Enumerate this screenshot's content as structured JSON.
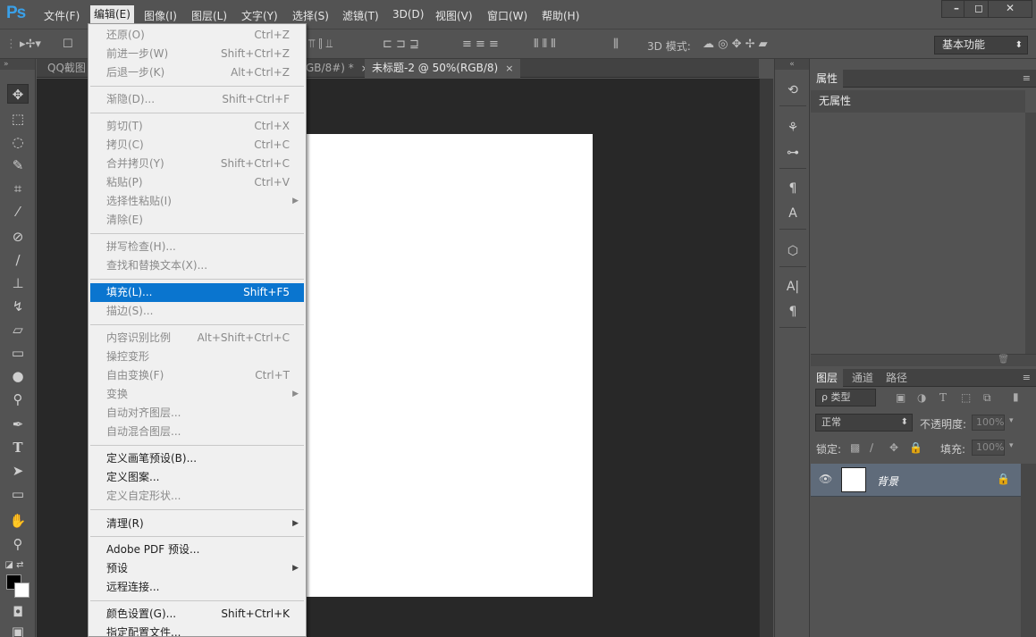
{
  "app": {
    "logo": "Ps",
    "menus": [
      "文件(F)",
      "编辑(E)",
      "图像(I)",
      "图层(L)",
      "文字(Y)",
      "选择(S)",
      "滤镜(T)",
      "3D(D)",
      "视图(V)",
      "窗口(W)",
      "帮助(H)"
    ],
    "window_controls": [
      "–",
      "◻",
      "✕"
    ]
  },
  "options_bar": {
    "mode_3d_label": "3D 模式:",
    "workspace": "基本功能"
  },
  "tabs": [
    {
      "label": "QQ截图",
      "close": ""
    },
    {
      "label": "GB/8#) *",
      "close": "×"
    },
    {
      "label": "未标题-2 @ 50%(RGB/8)",
      "close": "×"
    }
  ],
  "edit_menu": {
    "items": [
      {
        "label": "还原(O)",
        "shortcut": "Ctrl+Z",
        "disabled": true
      },
      {
        "label": "前进一步(W)",
        "shortcut": "Shift+Ctrl+Z",
        "disabled": true
      },
      {
        "label": "后退一步(K)",
        "shortcut": "Alt+Ctrl+Z",
        "disabled": true
      },
      {
        "label": "渐隐(D)...",
        "shortcut": "Shift+Ctrl+F",
        "disabled": true
      },
      {
        "label": "剪切(T)",
        "shortcut": "Ctrl+X",
        "disabled": true
      },
      {
        "label": "拷贝(C)",
        "shortcut": "Ctrl+C",
        "disabled": true
      },
      {
        "label": "合并拷贝(Y)",
        "shortcut": "Shift+Ctrl+C",
        "disabled": true
      },
      {
        "label": "粘贴(P)",
        "shortcut": "Ctrl+V",
        "disabled": true
      },
      {
        "label": "选择性粘贴(I)",
        "shortcut": "",
        "disabled": true,
        "submenu": true
      },
      {
        "label": "清除(E)",
        "shortcut": "",
        "disabled": true
      },
      {
        "label": "拼写检查(H)...",
        "shortcut": "",
        "disabled": true
      },
      {
        "label": "查找和替换文本(X)...",
        "shortcut": "",
        "disabled": true
      },
      {
        "label": "填充(L)...",
        "shortcut": "Shift+F5",
        "disabled": false,
        "highlighted": true
      },
      {
        "label": "描边(S)...",
        "shortcut": "",
        "disabled": true
      },
      {
        "label": "内容识别比例",
        "shortcut": "Alt+Shift+Ctrl+C",
        "disabled": true
      },
      {
        "label": "操控变形",
        "shortcut": "",
        "disabled": true
      },
      {
        "label": "自由变换(F)",
        "shortcut": "Ctrl+T",
        "disabled": true
      },
      {
        "label": "变换",
        "shortcut": "",
        "disabled": true,
        "submenu": true
      },
      {
        "label": "自动对齐图层...",
        "shortcut": "",
        "disabled": true
      },
      {
        "label": "自动混合图层...",
        "shortcut": "",
        "disabled": true
      },
      {
        "label": "定义画笔预设(B)...",
        "shortcut": "",
        "disabled": false
      },
      {
        "label": "定义图案...",
        "shortcut": "",
        "disabled": false
      },
      {
        "label": "定义自定形状...",
        "shortcut": "",
        "disabled": true
      },
      {
        "label": "清理(R)",
        "shortcut": "",
        "disabled": false,
        "submenu": true
      },
      {
        "label": "Adobe PDF 预设...",
        "shortcut": "",
        "disabled": false
      },
      {
        "label": "预设",
        "shortcut": "",
        "disabled": false,
        "submenu": true
      },
      {
        "label": "远程连接...",
        "shortcut": "",
        "disabled": false
      },
      {
        "label": "颜色设置(G)...",
        "shortcut": "Shift+Ctrl+K",
        "disabled": false
      },
      {
        "label": "指定配置文件...",
        "shortcut": "",
        "disabled": false
      }
    ]
  },
  "properties_panel": {
    "tab": "属性",
    "content": "无属性"
  },
  "layers_panel": {
    "tabs": [
      "图层",
      "通道",
      "路径"
    ],
    "filter_label": "ρ 类型",
    "blend_mode": "正常",
    "opacity_label": "不透明度:",
    "opacity_value": "100%",
    "lock_label": "锁定:",
    "fill_label": "填充:",
    "fill_value": "100%",
    "layer_name": "背景"
  },
  "colors": {
    "highlight": "#0a75cf",
    "foreground": "#000000",
    "background": "#ffffff"
  }
}
